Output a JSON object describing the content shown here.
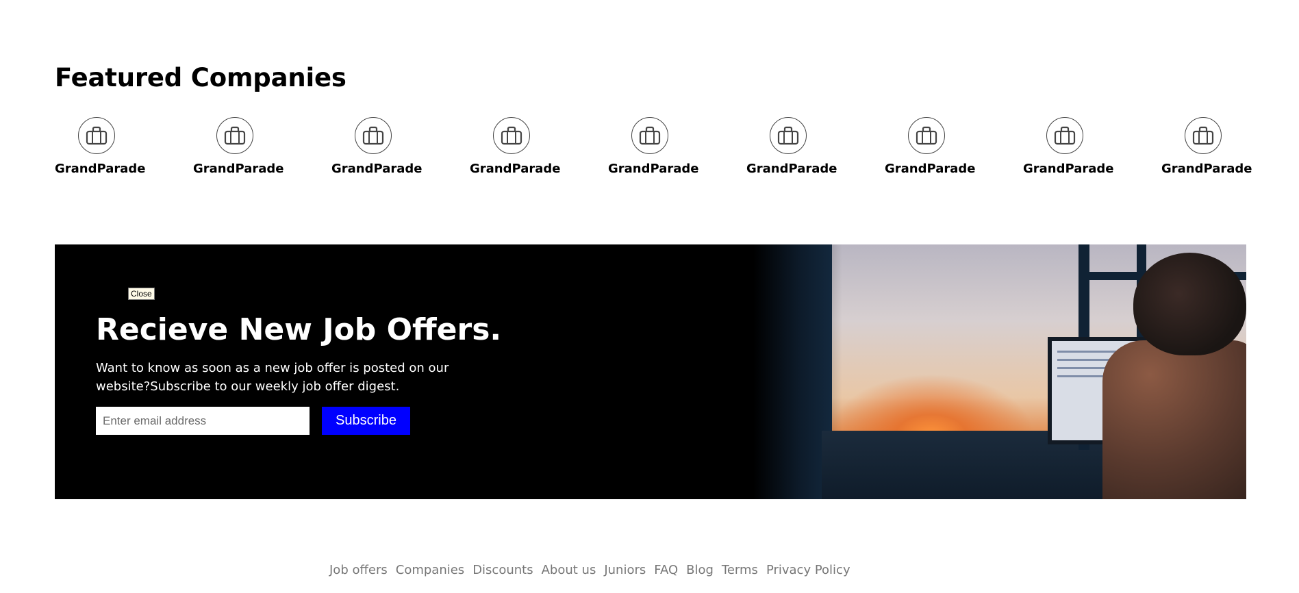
{
  "featured": {
    "title": "Featured Companies",
    "companies": [
      {
        "name": "GrandParade",
        "icon": "briefcase-icon"
      },
      {
        "name": "GrandParade",
        "icon": "briefcase-icon"
      },
      {
        "name": "GrandParade",
        "icon": "briefcase-icon"
      },
      {
        "name": "GrandParade",
        "icon": "briefcase-icon"
      },
      {
        "name": "GrandParade",
        "icon": "briefcase-icon"
      },
      {
        "name": "GrandParade",
        "icon": "briefcase-icon"
      },
      {
        "name": "GrandParade",
        "icon": "briefcase-icon"
      },
      {
        "name": "GrandParade",
        "icon": "briefcase-icon"
      },
      {
        "name": "GrandParade",
        "icon": "briefcase-icon"
      }
    ]
  },
  "newsletter": {
    "close_label": "Close",
    "title": "Recieve New Job Offers.",
    "description": "Want to know as soon as a new job offer is posted on our website?Subscribe to our weekly job offer digest.",
    "email_placeholder": "Enter email address",
    "email_value": "",
    "subscribe_label": "Subscribe",
    "accent_color": "#0000ff"
  },
  "footer": {
    "links": [
      "Job offers",
      "Companies",
      "Discounts",
      "About us",
      "Juniors",
      "FAQ",
      "Blog",
      "Terms",
      "Privacy Policy"
    ]
  }
}
